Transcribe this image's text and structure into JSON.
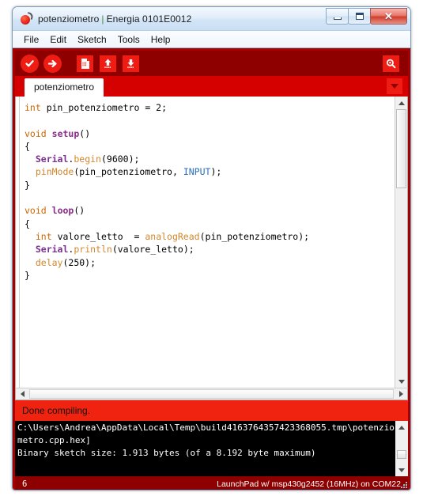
{
  "window": {
    "title_app": "potenziometro",
    "title_sep": "|",
    "title_suffix": "Energia 0101E0012",
    "app_icon": "energia-bulb-icon",
    "controls": {
      "minimize": "minimize-icon",
      "maximize": "maximize-icon",
      "close": "✕"
    }
  },
  "menubar": {
    "items": [
      {
        "label": "File"
      },
      {
        "label": "Edit"
      },
      {
        "label": "Sketch"
      },
      {
        "label": "Tools"
      },
      {
        "label": "Help"
      }
    ]
  },
  "toolbar": {
    "buttons": [
      {
        "name": "verify-button",
        "icon": "check-circle-icon",
        "tooltip": "Verify"
      },
      {
        "name": "upload-button",
        "icon": "arrow-right-circle-icon",
        "tooltip": "Upload"
      },
      {
        "name": "new-button",
        "icon": "new-file-icon",
        "tooltip": "New"
      },
      {
        "name": "open-button",
        "icon": "arrow-up-icon",
        "tooltip": "Open"
      },
      {
        "name": "save-button",
        "icon": "arrow-down-icon",
        "tooltip": "Save"
      }
    ],
    "serial_monitor": {
      "name": "serial-monitor-button",
      "icon": "magnifier-icon",
      "tooltip": "Serial Monitor"
    }
  },
  "tabs": {
    "active": "potenziometro",
    "dropdown_icon": "chevron-down-icon"
  },
  "editor": {
    "lines": [
      [
        {
          "t": "int",
          "c": "kw"
        },
        {
          "t": " pin_potenziometro = 2;",
          "c": ""
        }
      ],
      [
        {
          "t": "",
          "c": ""
        }
      ],
      [
        {
          "t": "void",
          "c": "kw"
        },
        {
          "t": " ",
          "c": ""
        },
        {
          "t": "setup",
          "c": "fn-def"
        },
        {
          "t": "()",
          "c": ""
        }
      ],
      [
        {
          "t": "{",
          "c": ""
        }
      ],
      [
        {
          "t": "  ",
          "c": ""
        },
        {
          "t": "Serial",
          "c": "cls"
        },
        {
          "t": ".",
          "c": ""
        },
        {
          "t": "begin",
          "c": "fn"
        },
        {
          "t": "(9600);",
          "c": ""
        }
      ],
      [
        {
          "t": "  ",
          "c": ""
        },
        {
          "t": "pinMode",
          "c": "fn"
        },
        {
          "t": "(pin_potenziometro, ",
          "c": ""
        },
        {
          "t": "INPUT",
          "c": "lit"
        },
        {
          "t": ");",
          "c": ""
        }
      ],
      [
        {
          "t": "}",
          "c": ""
        }
      ],
      [
        {
          "t": "",
          "c": ""
        }
      ],
      [
        {
          "t": "void",
          "c": "kw"
        },
        {
          "t": " ",
          "c": ""
        },
        {
          "t": "loop",
          "c": "fn-def"
        },
        {
          "t": "()",
          "c": ""
        }
      ],
      [
        {
          "t": "{",
          "c": ""
        }
      ],
      [
        {
          "t": "  ",
          "c": ""
        },
        {
          "t": "int",
          "c": "kw"
        },
        {
          "t": " valore_letto  = ",
          "c": ""
        },
        {
          "t": "analogRead",
          "c": "fn"
        },
        {
          "t": "(pin_potenziometro);",
          "c": ""
        }
      ],
      [
        {
          "t": "  ",
          "c": ""
        },
        {
          "t": "Serial",
          "c": "cls"
        },
        {
          "t": ".",
          "c": ""
        },
        {
          "t": "println",
          "c": "fn"
        },
        {
          "t": "(valore_letto);",
          "c": ""
        }
      ],
      [
        {
          "t": "  ",
          "c": ""
        },
        {
          "t": "delay",
          "c": "fn"
        },
        {
          "t": "(250);",
          "c": ""
        }
      ],
      [
        {
          "t": "}",
          "c": ""
        }
      ]
    ]
  },
  "status": {
    "message": "Done compiling."
  },
  "console": {
    "text": "C:\\Users\\Andrea\\AppData\\Local\\Temp\\build4163764357423368055.tmp\\potenziometro.cpp.hex]\nBinary sketch size: 1.913 bytes (of a 8.192 byte maximum)"
  },
  "bottombar": {
    "line_number": "6",
    "board_info": "LaunchPad w/ msp430g2452 (16MHz) on COM22"
  },
  "colors": {
    "toolbar_bg": "#8e0000",
    "tabstrip_bg": "#d50000",
    "icon_red": "#ee1c12",
    "status_red": "#f02311",
    "console_bg": "#000000",
    "keyword": "#cc6600",
    "function": "#d3872b",
    "class": "#7b2f8f",
    "literal": "#2a6fbb"
  }
}
